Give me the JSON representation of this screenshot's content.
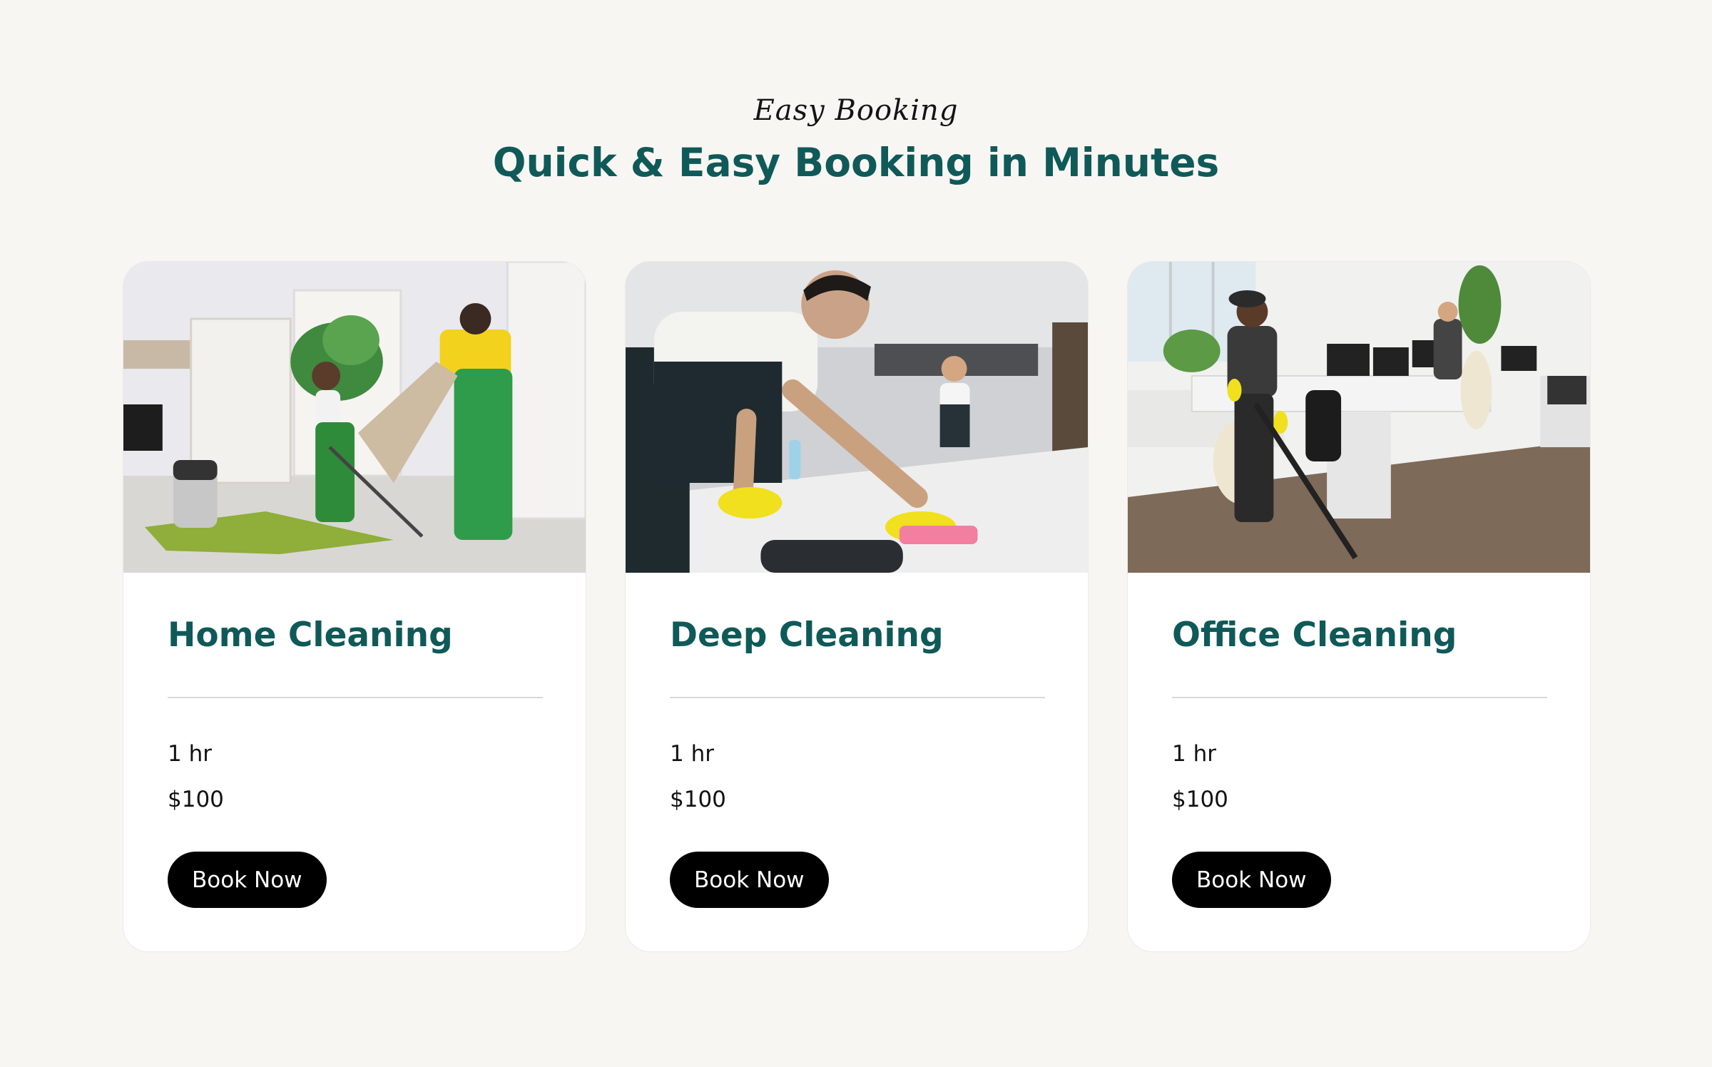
{
  "section": {
    "eyebrow": "Easy Booking",
    "title": "Quick & Easy Booking in Minutes"
  },
  "cards": [
    {
      "title": "Home Cleaning",
      "duration": "1 hr",
      "price": "$100",
      "button": "Book Now",
      "photo": "home-cleaning-photo"
    },
    {
      "title": "Deep Cleaning",
      "duration": "1 hr",
      "price": "$100",
      "button": "Book Now",
      "photo": "deep-cleaning-photo"
    },
    {
      "title": "Office Cleaning",
      "duration": "1 hr",
      "price": "$100",
      "button": "Book Now",
      "photo": "office-cleaning-photo"
    }
  ],
  "colors": {
    "accent": "#0f5a58",
    "background": "#f7f6f3",
    "button": "#000000"
  }
}
